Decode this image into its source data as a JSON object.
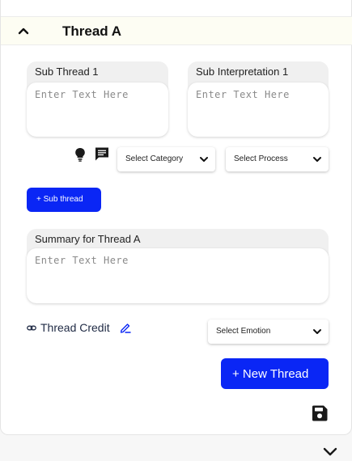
{
  "thread": {
    "title": "Thread A",
    "sub_thread": {
      "label": "Sub Thread 1",
      "placeholder": "Enter Text Here"
    },
    "sub_interpretation": {
      "label": "Sub Interpretation 1",
      "placeholder": "Enter Text Here"
    },
    "category_select": {
      "value": "Select Category"
    },
    "process_select": {
      "value": "Select Process"
    },
    "add_sub_thread_label": "+ Sub thread",
    "summary": {
      "label": "Summary for Thread A",
      "placeholder": "Enter Text Here"
    },
    "credit_label": "Thread Credit",
    "emotion_select": {
      "value": "Select Emotion"
    },
    "new_thread_label": "+ New Thread"
  },
  "icons": {
    "collapse": "chevron-up-icon",
    "idea": "lightbulb-icon",
    "comment": "comment-icon",
    "link": "link-icon",
    "edit": "pen-icon",
    "save": "floppy-disk-icon",
    "expand": "chevron-down-icon"
  },
  "colors": {
    "accent": "#0a26f5",
    "header_bg": "#fdfdf3"
  }
}
